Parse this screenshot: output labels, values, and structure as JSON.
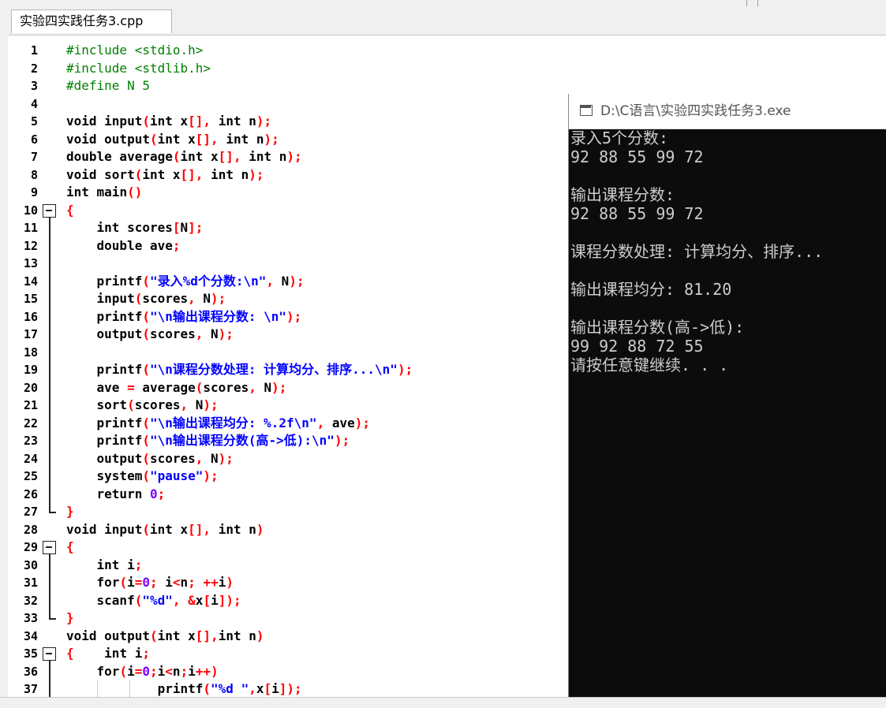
{
  "tab": {
    "label": "实验四实践任务3.cpp"
  },
  "editor": {
    "lines": [
      {
        "n": "1",
        "segs": [
          {
            "t": "pp",
            "v": "#include <stdio.h>"
          }
        ]
      },
      {
        "n": "2",
        "segs": [
          {
            "t": "pp",
            "v": "#include <stdlib.h>"
          }
        ]
      },
      {
        "n": "3",
        "segs": [
          {
            "t": "pp",
            "v": "#define N 5"
          }
        ]
      },
      {
        "n": "4",
        "segs": []
      },
      {
        "n": "5",
        "segs": [
          {
            "t": "kw",
            "v": "void"
          },
          {
            "t": "tx",
            "v": " input"
          },
          {
            "t": "sy",
            "v": "("
          },
          {
            "t": "kw",
            "v": "int"
          },
          {
            "t": "tx",
            "v": " x"
          },
          {
            "t": "sy",
            "v": "[],"
          },
          {
            "t": "tx",
            "v": " "
          },
          {
            "t": "kw",
            "v": "int"
          },
          {
            "t": "tx",
            "v": " n"
          },
          {
            "t": "sy",
            "v": ");"
          }
        ]
      },
      {
        "n": "6",
        "segs": [
          {
            "t": "kw",
            "v": "void"
          },
          {
            "t": "tx",
            "v": " output"
          },
          {
            "t": "sy",
            "v": "("
          },
          {
            "t": "kw",
            "v": "int"
          },
          {
            "t": "tx",
            "v": " x"
          },
          {
            "t": "sy",
            "v": "[],"
          },
          {
            "t": "tx",
            "v": " "
          },
          {
            "t": "kw",
            "v": "int"
          },
          {
            "t": "tx",
            "v": " n"
          },
          {
            "t": "sy",
            "v": ");"
          }
        ]
      },
      {
        "n": "7",
        "segs": [
          {
            "t": "kw",
            "v": "double"
          },
          {
            "t": "tx",
            "v": " average"
          },
          {
            "t": "sy",
            "v": "("
          },
          {
            "t": "kw",
            "v": "int"
          },
          {
            "t": "tx",
            "v": " x"
          },
          {
            "t": "sy",
            "v": "[],"
          },
          {
            "t": "tx",
            "v": " "
          },
          {
            "t": "kw",
            "v": "int"
          },
          {
            "t": "tx",
            "v": " n"
          },
          {
            "t": "sy",
            "v": ");"
          }
        ]
      },
      {
        "n": "8",
        "segs": [
          {
            "t": "kw",
            "v": "void"
          },
          {
            "t": "tx",
            "v": " sort"
          },
          {
            "t": "sy",
            "v": "("
          },
          {
            "t": "kw",
            "v": "int"
          },
          {
            "t": "tx",
            "v": " x"
          },
          {
            "t": "sy",
            "v": "[],"
          },
          {
            "t": "tx",
            "v": " "
          },
          {
            "t": "kw",
            "v": "int"
          },
          {
            "t": "tx",
            "v": " n"
          },
          {
            "t": "sy",
            "v": ");"
          }
        ]
      },
      {
        "n": "9",
        "segs": [
          {
            "t": "kw",
            "v": "int"
          },
          {
            "t": "tx",
            "v": " main"
          },
          {
            "t": "sy",
            "v": "()"
          }
        ]
      },
      {
        "n": "10",
        "segs": [
          {
            "t": "sy",
            "v": "{"
          }
        ]
      },
      {
        "n": "11",
        "segs": [
          {
            "t": "tx",
            "v": "    "
          },
          {
            "t": "kw",
            "v": "int"
          },
          {
            "t": "tx",
            "v": " scores"
          },
          {
            "t": "sy",
            "v": "["
          },
          {
            "t": "tx",
            "v": "N"
          },
          {
            "t": "sy",
            "v": "];"
          }
        ]
      },
      {
        "n": "12",
        "segs": [
          {
            "t": "tx",
            "v": "    "
          },
          {
            "t": "kw",
            "v": "double"
          },
          {
            "t": "tx",
            "v": " ave"
          },
          {
            "t": "sy",
            "v": ";"
          }
        ]
      },
      {
        "n": "13",
        "segs": []
      },
      {
        "n": "14",
        "segs": [
          {
            "t": "tx",
            "v": "    printf"
          },
          {
            "t": "sy",
            "v": "("
          },
          {
            "t": "st",
            "v": "\"录入%d个分数:\\n\""
          },
          {
            "t": "sy",
            "v": ","
          },
          {
            "t": "tx",
            "v": " N"
          },
          {
            "t": "sy",
            "v": ");"
          }
        ]
      },
      {
        "n": "15",
        "segs": [
          {
            "t": "tx",
            "v": "    input"
          },
          {
            "t": "sy",
            "v": "("
          },
          {
            "t": "tx",
            "v": "scores"
          },
          {
            "t": "sy",
            "v": ","
          },
          {
            "t": "tx",
            "v": " N"
          },
          {
            "t": "sy",
            "v": ");"
          }
        ]
      },
      {
        "n": "16",
        "segs": [
          {
            "t": "tx",
            "v": "    printf"
          },
          {
            "t": "sy",
            "v": "("
          },
          {
            "t": "st",
            "v": "\"\\n输出课程分数: \\n\""
          },
          {
            "t": "sy",
            "v": ");"
          }
        ]
      },
      {
        "n": "17",
        "segs": [
          {
            "t": "tx",
            "v": "    output"
          },
          {
            "t": "sy",
            "v": "("
          },
          {
            "t": "tx",
            "v": "scores"
          },
          {
            "t": "sy",
            "v": ","
          },
          {
            "t": "tx",
            "v": " N"
          },
          {
            "t": "sy",
            "v": ");"
          }
        ]
      },
      {
        "n": "18",
        "segs": []
      },
      {
        "n": "19",
        "segs": [
          {
            "t": "tx",
            "v": "    printf"
          },
          {
            "t": "sy",
            "v": "("
          },
          {
            "t": "st",
            "v": "\"\\n课程分数处理: 计算均分、排序...\\n\""
          },
          {
            "t": "sy",
            "v": ");"
          }
        ]
      },
      {
        "n": "20",
        "segs": [
          {
            "t": "tx",
            "v": "    ave "
          },
          {
            "t": "sy",
            "v": "="
          },
          {
            "t": "tx",
            "v": " average"
          },
          {
            "t": "sy",
            "v": "("
          },
          {
            "t": "tx",
            "v": "scores"
          },
          {
            "t": "sy",
            "v": ","
          },
          {
            "t": "tx",
            "v": " N"
          },
          {
            "t": "sy",
            "v": ");"
          }
        ]
      },
      {
        "n": "21",
        "segs": [
          {
            "t": "tx",
            "v": "    sort"
          },
          {
            "t": "sy",
            "v": "("
          },
          {
            "t": "tx",
            "v": "scores"
          },
          {
            "t": "sy",
            "v": ","
          },
          {
            "t": "tx",
            "v": " N"
          },
          {
            "t": "sy",
            "v": ");"
          }
        ]
      },
      {
        "n": "22",
        "segs": [
          {
            "t": "tx",
            "v": "    printf"
          },
          {
            "t": "sy",
            "v": "("
          },
          {
            "t": "st",
            "v": "\"\\n输出课程均分: %.2f\\n\""
          },
          {
            "t": "sy",
            "v": ","
          },
          {
            "t": "tx",
            "v": " ave"
          },
          {
            "t": "sy",
            "v": ");"
          }
        ]
      },
      {
        "n": "23",
        "segs": [
          {
            "t": "tx",
            "v": "    printf"
          },
          {
            "t": "sy",
            "v": "("
          },
          {
            "t": "st",
            "v": "\"\\n输出课程分数(高->低):\\n\""
          },
          {
            "t": "sy",
            "v": ");"
          }
        ]
      },
      {
        "n": "24",
        "segs": [
          {
            "t": "tx",
            "v": "    output"
          },
          {
            "t": "sy",
            "v": "("
          },
          {
            "t": "tx",
            "v": "scores"
          },
          {
            "t": "sy",
            "v": ","
          },
          {
            "t": "tx",
            "v": " N"
          },
          {
            "t": "sy",
            "v": ");"
          }
        ]
      },
      {
        "n": "25",
        "segs": [
          {
            "t": "tx",
            "v": "    system"
          },
          {
            "t": "sy",
            "v": "("
          },
          {
            "t": "st",
            "v": "\"pause\""
          },
          {
            "t": "sy",
            "v": ");"
          }
        ]
      },
      {
        "n": "26",
        "segs": [
          {
            "t": "tx",
            "v": "    "
          },
          {
            "t": "kw",
            "v": "return"
          },
          {
            "t": "tx",
            "v": " "
          },
          {
            "t": "nu",
            "v": "0"
          },
          {
            "t": "sy",
            "v": ";"
          }
        ]
      },
      {
        "n": "27",
        "segs": [
          {
            "t": "sy",
            "v": "}"
          }
        ]
      },
      {
        "n": "28",
        "segs": [
          {
            "t": "kw",
            "v": "void"
          },
          {
            "t": "tx",
            "v": " input"
          },
          {
            "t": "sy",
            "v": "("
          },
          {
            "t": "kw",
            "v": "int"
          },
          {
            "t": "tx",
            "v": " x"
          },
          {
            "t": "sy",
            "v": "[],"
          },
          {
            "t": "tx",
            "v": " "
          },
          {
            "t": "kw",
            "v": "int"
          },
          {
            "t": "tx",
            "v": " n"
          },
          {
            "t": "sy",
            "v": ")"
          }
        ]
      },
      {
        "n": "29",
        "segs": [
          {
            "t": "sy",
            "v": "{"
          }
        ]
      },
      {
        "n": "30",
        "segs": [
          {
            "t": "tx",
            "v": "    "
          },
          {
            "t": "kw",
            "v": "int"
          },
          {
            "t": "tx",
            "v": " i"
          },
          {
            "t": "sy",
            "v": ";"
          }
        ]
      },
      {
        "n": "31",
        "segs": [
          {
            "t": "tx",
            "v": "    "
          },
          {
            "t": "kw",
            "v": "for"
          },
          {
            "t": "sy",
            "v": "("
          },
          {
            "t": "tx",
            "v": "i"
          },
          {
            "t": "sy",
            "v": "="
          },
          {
            "t": "nu",
            "v": "0"
          },
          {
            "t": "sy",
            "v": ";"
          },
          {
            "t": "tx",
            "v": " i"
          },
          {
            "t": "sy",
            "v": "<"
          },
          {
            "t": "tx",
            "v": "n"
          },
          {
            "t": "sy",
            "v": ";"
          },
          {
            "t": "tx",
            "v": " "
          },
          {
            "t": "sy",
            "v": "++"
          },
          {
            "t": "tx",
            "v": "i"
          },
          {
            "t": "sy",
            "v": ")"
          }
        ]
      },
      {
        "n": "32",
        "segs": [
          {
            "t": "tx",
            "v": "    scanf"
          },
          {
            "t": "sy",
            "v": "("
          },
          {
            "t": "st",
            "v": "\"%d\""
          },
          {
            "t": "sy",
            "v": ","
          },
          {
            "t": "tx",
            "v": " "
          },
          {
            "t": "sy",
            "v": "&"
          },
          {
            "t": "tx",
            "v": "x"
          },
          {
            "t": "sy",
            "v": "["
          },
          {
            "t": "tx",
            "v": "i"
          },
          {
            "t": "sy",
            "v": "]);"
          }
        ]
      },
      {
        "n": "33",
        "segs": [
          {
            "t": "sy",
            "v": "}"
          }
        ]
      },
      {
        "n": "34",
        "segs": [
          {
            "t": "kw",
            "v": "void"
          },
          {
            "t": "tx",
            "v": " output"
          },
          {
            "t": "sy",
            "v": "("
          },
          {
            "t": "kw",
            "v": "int"
          },
          {
            "t": "tx",
            "v": " x"
          },
          {
            "t": "sy",
            "v": "[],"
          },
          {
            "t": "kw",
            "v": "int"
          },
          {
            "t": "tx",
            "v": " n"
          },
          {
            "t": "sy",
            "v": ")"
          }
        ]
      },
      {
        "n": "35",
        "segs": [
          {
            "t": "sy",
            "v": "{"
          },
          {
            "t": "tx",
            "v": "    "
          },
          {
            "t": "kw",
            "v": "int"
          },
          {
            "t": "tx",
            "v": " i"
          },
          {
            "t": "sy",
            "v": ";"
          }
        ]
      },
      {
        "n": "36",
        "segs": [
          {
            "t": "tx",
            "v": "    "
          },
          {
            "t": "kw",
            "v": "for"
          },
          {
            "t": "sy",
            "v": "("
          },
          {
            "t": "tx",
            "v": "i"
          },
          {
            "t": "sy",
            "v": "="
          },
          {
            "t": "nu",
            "v": "0"
          },
          {
            "t": "sy",
            "v": ";"
          },
          {
            "t": "tx",
            "v": "i"
          },
          {
            "t": "sy",
            "v": "<"
          },
          {
            "t": "tx",
            "v": "n"
          },
          {
            "t": "sy",
            "v": ";"
          },
          {
            "t": "tx",
            "v": "i"
          },
          {
            "t": "sy",
            "v": "++)"
          }
        ]
      },
      {
        "n": "37",
        "segs": [
          {
            "t": "tx",
            "v": "            printf"
          },
          {
            "t": "sy",
            "v": "("
          },
          {
            "t": "st",
            "v": "\"%d \""
          },
          {
            "t": "sy",
            "v": ","
          },
          {
            "t": "tx",
            "v": "x"
          },
          {
            "t": "sy",
            "v": "["
          },
          {
            "t": "tx",
            "v": "i"
          },
          {
            "t": "sy",
            "v": "]);"
          }
        ]
      }
    ],
    "fold_lines": [
      "10",
      "29",
      "35"
    ]
  },
  "console": {
    "title": "D:\\C语言\\实验四实践任务3.exe",
    "lines": [
      "录入5个分数:",
      "92 88 55 99 72",
      "",
      "输出课程分数:",
      "92 88 55 99 72",
      "",
      "课程分数处理: 计算均分、排序...",
      "",
      "输出课程均分: 81.20",
      "",
      "输出课程分数(高->低):",
      "99 92 88 72 55",
      "请按任意键继续. . ."
    ]
  },
  "colors": {
    "preprocessor": "#008000",
    "symbol": "#ff0000",
    "string": "#0000ff",
    "number": "#8000ff",
    "console_bg": "#0c0c0c",
    "console_text": "#cccccc"
  }
}
